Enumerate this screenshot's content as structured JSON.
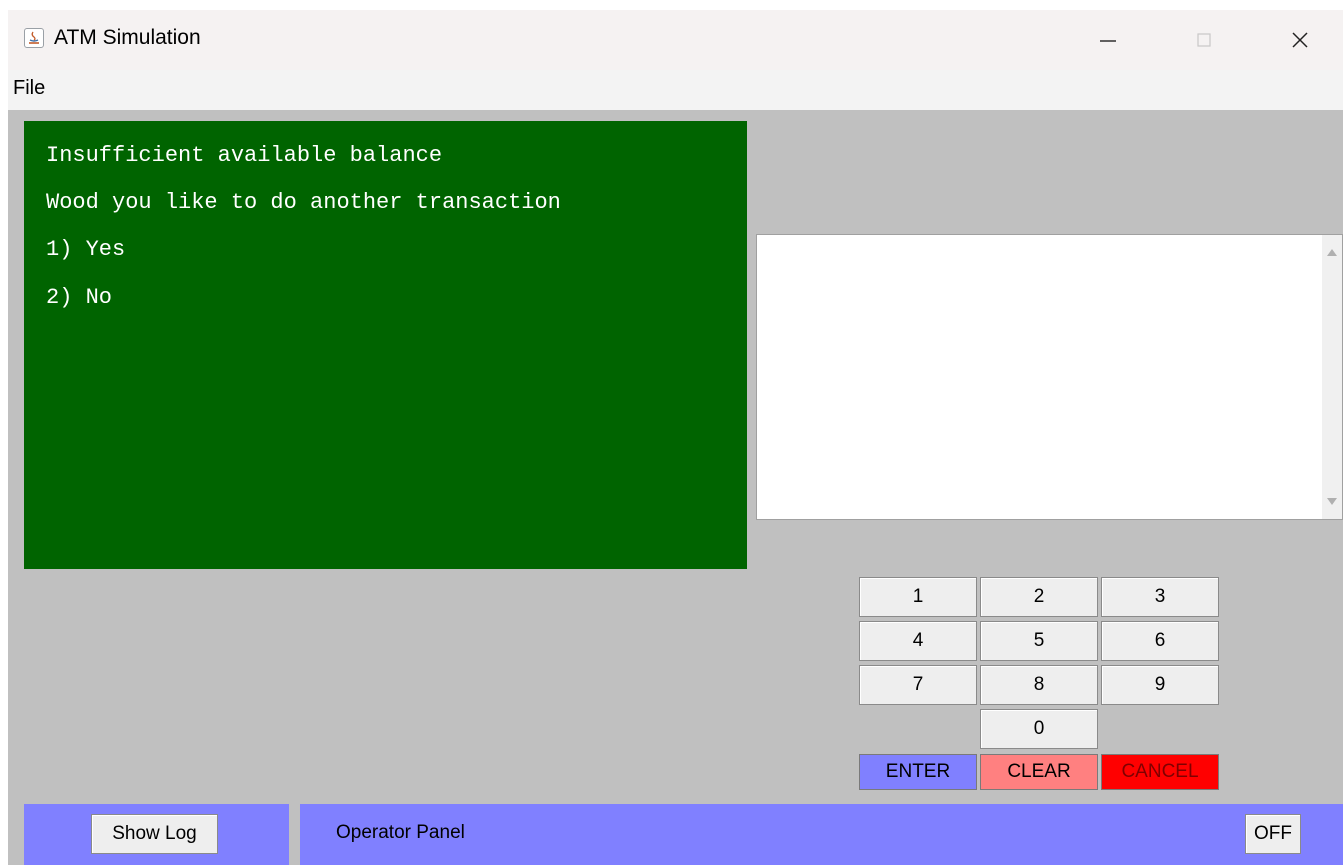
{
  "window": {
    "title": "ATM Simulation",
    "controls": [
      "minimize-icon",
      "maximize-icon",
      "close-icon"
    ]
  },
  "menu": {
    "file": "File"
  },
  "screen": {
    "lines": [
      "Insufficient available balance",
      "Wood you like to do another transaction",
      "1) Yes",
      "2) No"
    ]
  },
  "log": {
    "content": ""
  },
  "keypad": {
    "digits": [
      "1",
      "2",
      "3",
      "4",
      "5",
      "6",
      "7",
      "8",
      "9",
      "0"
    ],
    "enter": "ENTER",
    "clear": "CLEAR",
    "cancel": "CANCEL"
  },
  "bottom": {
    "show_log": "Show Log",
    "operator_panel": "Operator Panel",
    "power": "OFF"
  },
  "colors": {
    "screen_bg": "#006400",
    "panel_bg": "#c0c0c0",
    "operator_bg": "#8080ff",
    "enter_bg": "#8080ff",
    "clear_bg": "#ff8080",
    "cancel_bg": "#ff0000"
  }
}
